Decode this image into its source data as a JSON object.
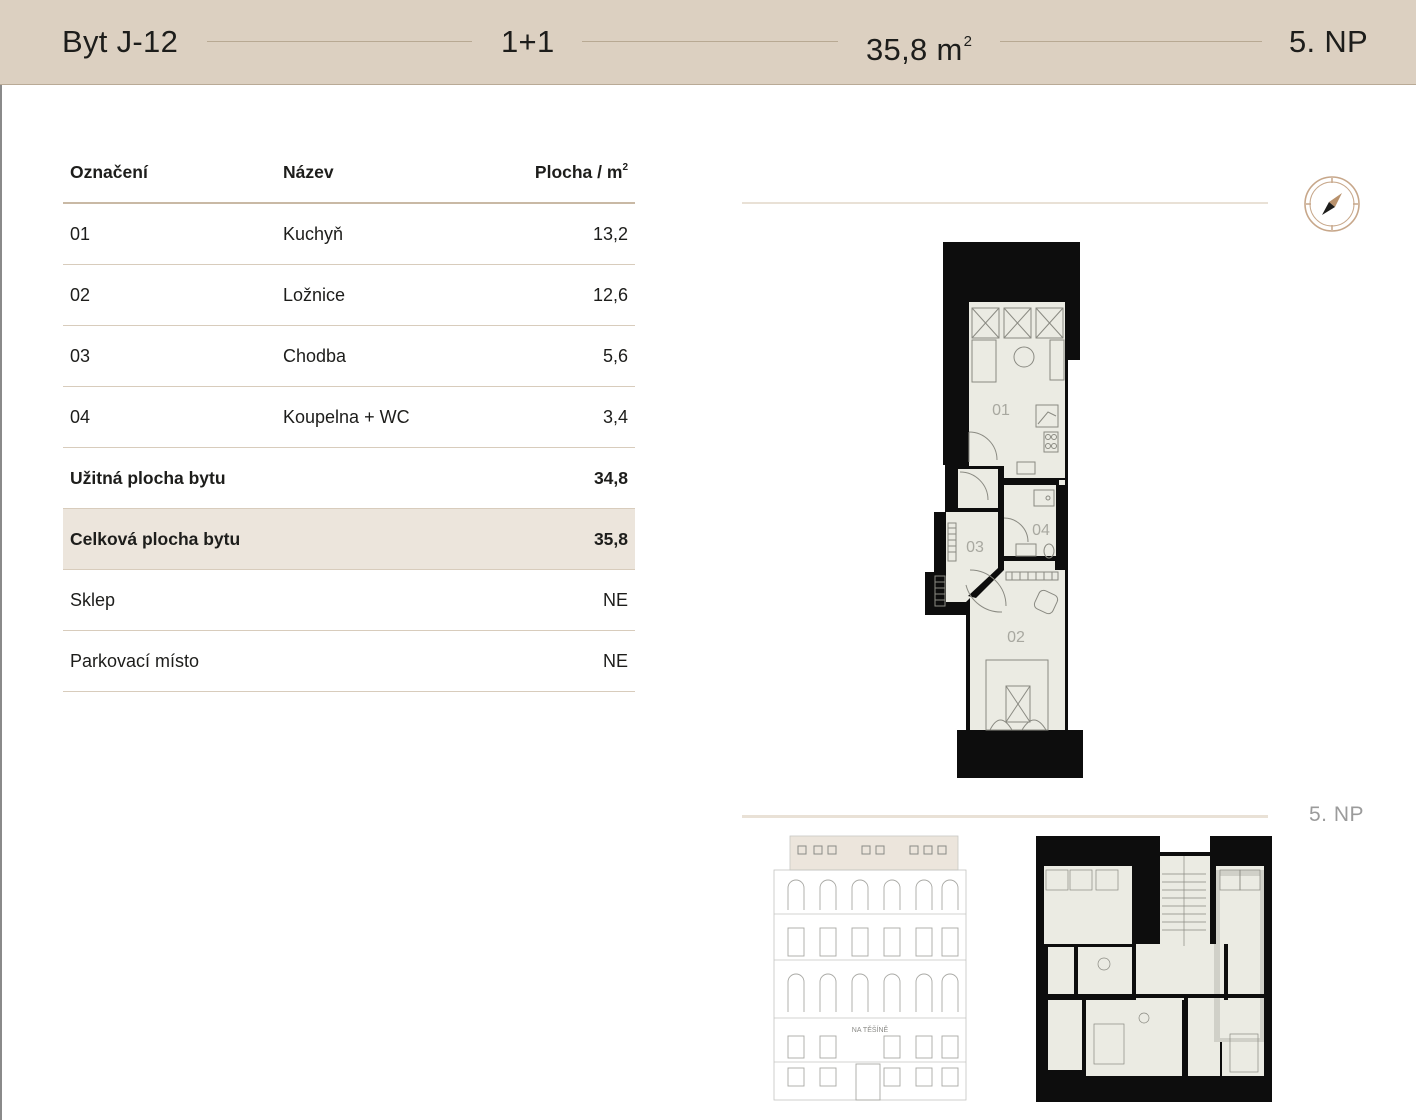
{
  "header": {
    "unit_name": "Byt J-12",
    "layout": "1+1",
    "area_value": "35,8 m",
    "area_exp": "2",
    "floor": "5. NP"
  },
  "table": {
    "col_label": "Označení",
    "col_name": "Název",
    "col_area": "Plocha / m",
    "col_area_exp": "2",
    "rooms": [
      {
        "id": "01",
        "name": "Kuchyň",
        "area": "13,2"
      },
      {
        "id": "02",
        "name": "Ložnice",
        "area": "12,6"
      },
      {
        "id": "03",
        "name": "Chodba",
        "area": "5,6"
      },
      {
        "id": "04",
        "name": "Koupelna + WC",
        "area": "3,4"
      }
    ],
    "usable_label": "Užitná plocha bytu",
    "usable_value": "34,8",
    "total_label": "Celková plocha bytu",
    "total_value": "35,8",
    "cellar_label": "Sklep",
    "cellar_value": "NE",
    "parking_label": "Parkovací místo",
    "parking_value": "NE"
  },
  "plan": {
    "room_labels": [
      "01",
      "02",
      "03",
      "04"
    ]
  },
  "building": {
    "floor_label": "5. NP",
    "facade_sign": "NA TĚŠÍNĚ"
  },
  "colors": {
    "header_bg": "#dcd0c1",
    "accent": "#c9b9a5",
    "wall": "#0d0d0d",
    "room_fill": "#ebebe3"
  }
}
